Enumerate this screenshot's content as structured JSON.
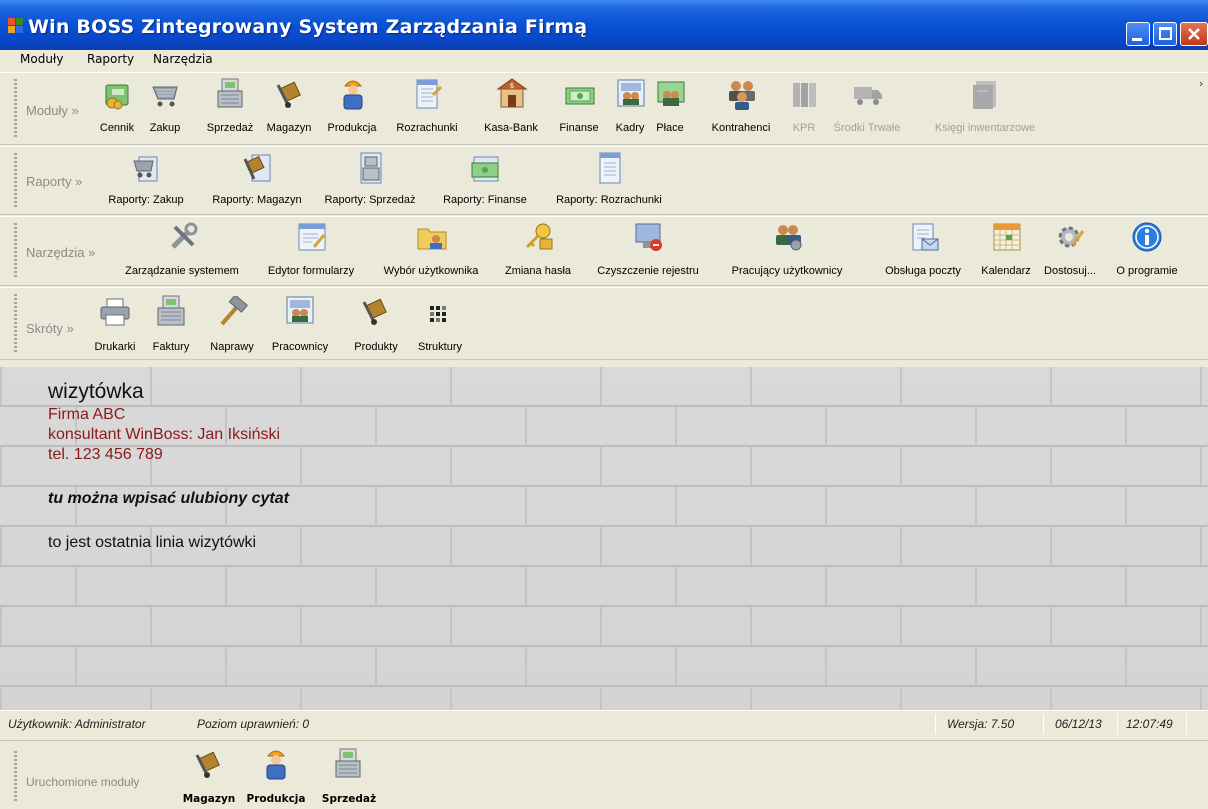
{
  "window": {
    "title": "Win BOSS Zintegrowany System Zarządzania Firmą"
  },
  "menu": [
    "Moduły",
    "Raporty",
    "Narzędzia"
  ],
  "bands": {
    "moduly": {
      "label": "Moduły »",
      "items": [
        {
          "label": "Cennik",
          "icon": "price-list-icon",
          "enabled": true
        },
        {
          "label": "Zakup",
          "icon": "shopping-cart-icon",
          "enabled": true
        },
        {
          "label": "Sprzedaż",
          "icon": "cash-register-icon",
          "enabled": true
        },
        {
          "label": "Magazyn",
          "icon": "hand-truck-icon",
          "enabled": true
        },
        {
          "label": "Produkcja",
          "icon": "worker-icon",
          "enabled": true
        },
        {
          "label": "Rozrachunki",
          "icon": "ledger-icon",
          "enabled": true
        },
        {
          "label": "Kasa-Bank",
          "icon": "bank-icon",
          "enabled": true
        },
        {
          "label": "Finanse",
          "icon": "banknote-icon",
          "enabled": true
        },
        {
          "label": "Kadry",
          "icon": "staff-board-icon",
          "enabled": true
        },
        {
          "label": "Płace",
          "icon": "payroll-icon",
          "enabled": true
        },
        {
          "label": "Kontrahenci",
          "icon": "contractors-icon",
          "enabled": true
        },
        {
          "label": "KPR",
          "icon": "binders-icon",
          "enabled": false
        },
        {
          "label": "Środki Trwałe",
          "icon": "truck-icon",
          "enabled": false
        },
        {
          "label": "Księgi inwentarzowe",
          "icon": "inventory-books-icon",
          "enabled": false
        }
      ]
    },
    "raporty": {
      "label": "Raporty »",
      "items": [
        {
          "label": "Raporty: Zakup",
          "icon": "report-cart-icon"
        },
        {
          "label": "Raporty: Magazyn",
          "icon": "report-hand-truck-icon"
        },
        {
          "label": "Raporty: Sprzedaż",
          "icon": "report-register-icon"
        },
        {
          "label": "Raporty: Finanse",
          "icon": "report-banknote-icon"
        },
        {
          "label": "Raporty: Rozrachunki",
          "icon": "report-ledger-icon"
        }
      ]
    },
    "narzedzia": {
      "label": "Narzędzia »",
      "items": [
        {
          "label": "Zarządzanie systemem",
          "icon": "tools-icon"
        },
        {
          "label": "Edytor formularzy",
          "icon": "form-editor-icon"
        },
        {
          "label": "Wybór użytkownika",
          "icon": "user-folder-icon"
        },
        {
          "label": "Zmiana hasła",
          "icon": "key-lock-icon"
        },
        {
          "label": "Czyszczenie rejestru",
          "icon": "registry-clean-icon"
        },
        {
          "label": "Pracujący użytkownicy",
          "icon": "active-users-icon"
        },
        {
          "label": "Obsługa poczty",
          "icon": "mail-icon"
        },
        {
          "label": "Kalendarz",
          "icon": "calendar-icon"
        },
        {
          "label": "Dostosuj...",
          "icon": "gear-icon"
        },
        {
          "label": "O programie",
          "icon": "info-icon"
        }
      ]
    },
    "skroty": {
      "label": "Skróty »",
      "items": [
        {
          "label": "Drukarki",
          "icon": "printer-icon"
        },
        {
          "label": "Faktury",
          "icon": "invoice-register-icon"
        },
        {
          "label": "Naprawy",
          "icon": "hammer-icon"
        },
        {
          "label": "Pracownicy",
          "icon": "employees-icon"
        },
        {
          "label": "Produkty",
          "icon": "products-icon"
        },
        {
          "label": "Struktury",
          "icon": "structure-grid-icon"
        }
      ]
    }
  },
  "card": {
    "title": "wizytówka",
    "company": "Firma ABC",
    "consultant": "konsultant WinBoss: Jan Iksiński",
    "phone": "tel. 123 456 789",
    "quote": "tu można wpisać ulubiony cytat",
    "last_line": "to jest ostatnia linia wizytówki"
  },
  "status": {
    "user": "Użytkownik: Administrator",
    "level": "Poziom uprawnień: 0",
    "version": "Wersja: 7.50",
    "date": "06/12/13",
    "time": "12:07:49"
  },
  "running": {
    "label": "Uruchomione moduły",
    "items": [
      {
        "label": "Magazyn",
        "icon": "hand-truck-icon"
      },
      {
        "label": "Produkcja",
        "icon": "worker-icon"
      },
      {
        "label": "Sprzedaż",
        "icon": "cash-register-icon"
      }
    ]
  },
  "colors": {
    "title_bar": "#0a54d6",
    "card_accent": "#8b1a1a",
    "toolbar_bg": "#ebe9d9"
  }
}
